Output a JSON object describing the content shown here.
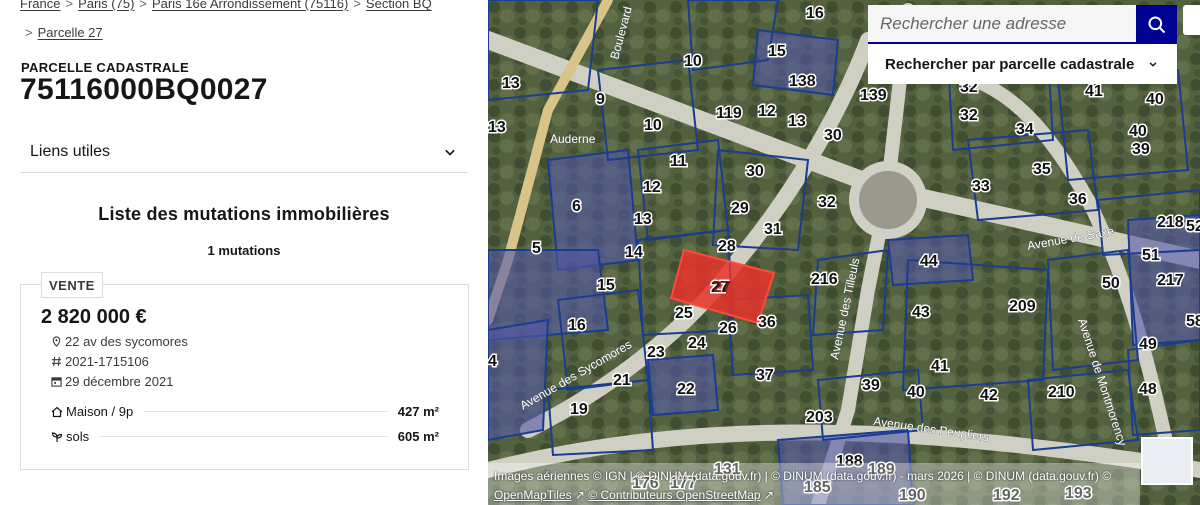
{
  "breadcrumb": {
    "items": [
      "France",
      "Paris (75)",
      "Paris 16e Arrondissement (75116)",
      "Section BQ"
    ],
    "current": "Parcelle 27",
    "separator": ">"
  },
  "parcel": {
    "kicker": "PARCELLE CADASTRALE",
    "id": "75116000BQ0027"
  },
  "useful_links": {
    "label": "Liens utiles"
  },
  "mutations": {
    "title": "Liste des mutations immobilières",
    "count": "1 mutations",
    "items": [
      {
        "type": "VENTE",
        "price": "2 820 000 €",
        "address": "22 av des sycomores",
        "reference": "2021-1715106",
        "date": "29 décembre 2021",
        "lines": [
          {
            "label": "Maison / 9p",
            "value": "427 m²",
            "icon": "home-icon"
          },
          {
            "label": "sols",
            "value": "605 m²",
            "icon": "plant-icon"
          }
        ]
      }
    ]
  },
  "map": {
    "search_placeholder": "Rechercher une adresse",
    "cadastre_search_label": "Rechercher par parcelle cadastrale",
    "highlighted_parcel": "27",
    "parcel_labels": [
      "16",
      "15",
      "10",
      "138",
      "139",
      "32",
      "41",
      "40",
      "13",
      "9",
      "119",
      "12",
      "13",
      "30",
      "32",
      "34",
      "40",
      "13",
      "10",
      "11",
      "30",
      "35",
      "39",
      "12",
      "29",
      "32",
      "33",
      "36",
      "6",
      "13",
      "31",
      "218",
      "52",
      "5",
      "14",
      "28",
      "44",
      "51",
      "217",
      "15",
      "27",
      "216",
      "50",
      "16",
      "25",
      "36",
      "43",
      "209",
      "58",
      "4",
      "26",
      "24",
      "23",
      "49",
      "21",
      "22",
      "37",
      "39",
      "41",
      "40",
      "42",
      "210",
      "48",
      "19",
      "203",
      "188",
      "189",
      "131",
      "176",
      "177",
      "185",
      "190",
      "192",
      "193"
    ],
    "street_labels": [
      "Avenue de Saxe",
      "Avenue des Sycomores",
      "Avenue des Peupliers",
      "Avenue des Tilleuls",
      "Avenue de Montmorency",
      "Boulevard",
      "Auderne"
    ],
    "attribution": {
      "line1": "Images aériennes © IGN | © DINUM (data.gouv.fr) | © DINUM (data.gouv.fr) - mars 2026 | © DINUM (data.gouv.fr)",
      "line1_tail": "©",
      "line2a": "OpenMapTiles",
      "line2b": "© Contributeurs OpenStreetMap"
    },
    "colors": {
      "accent_blue": "#000091",
      "parcel_outline": "#1a3d8f",
      "highlight": "#e8322a"
    }
  }
}
